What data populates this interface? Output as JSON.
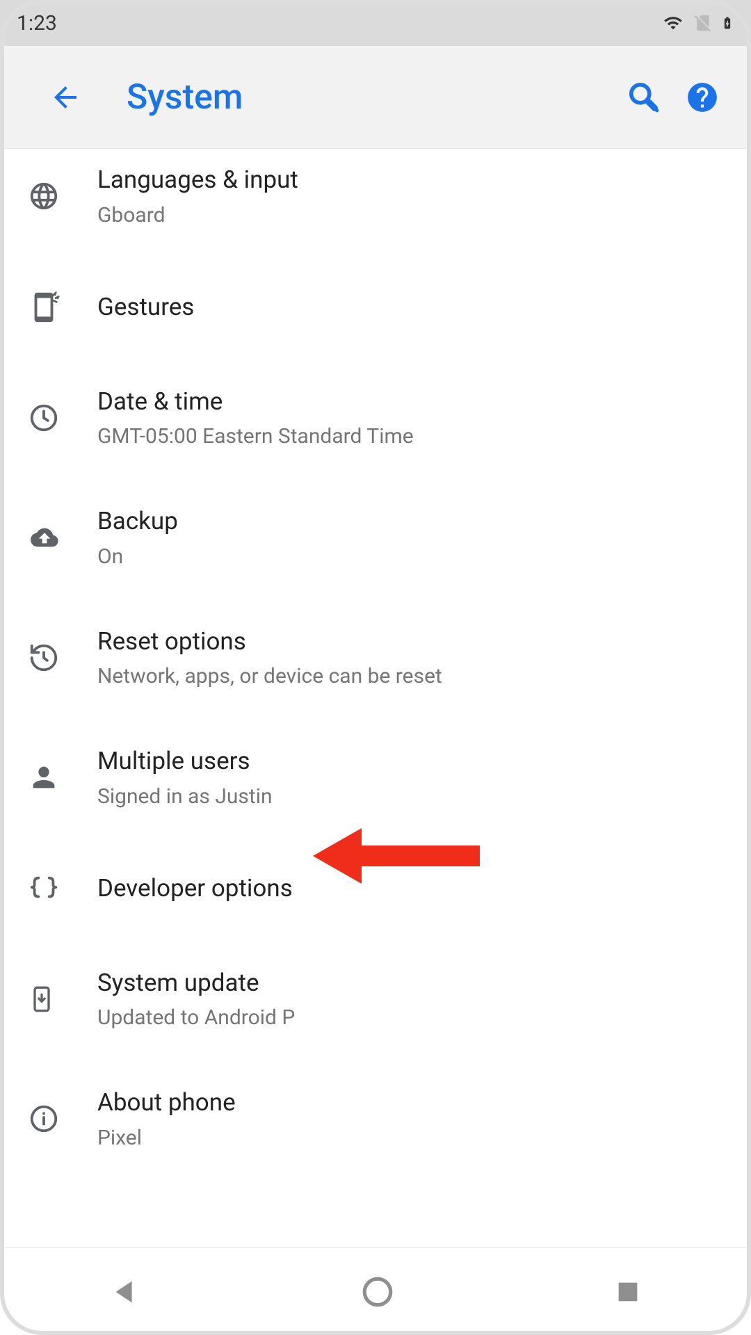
{
  "status": {
    "time": "1:23"
  },
  "appbar": {
    "title": "System"
  },
  "items": [
    {
      "label": "Languages & input",
      "sub": "Gboard"
    },
    {
      "label": "Gestures",
      "sub": ""
    },
    {
      "label": "Date & time",
      "sub": "GMT-05:00 Eastern Standard Time"
    },
    {
      "label": "Backup",
      "sub": "On"
    },
    {
      "label": "Reset options",
      "sub": "Network, apps, or device can be reset"
    },
    {
      "label": "Multiple users",
      "sub": "Signed in as Justin"
    },
    {
      "label": "Developer options",
      "sub": ""
    },
    {
      "label": "System update",
      "sub": "Updated to Android P"
    },
    {
      "label": "About phone",
      "sub": "Pixel"
    }
  ],
  "colors": {
    "accent": "#1a73e8",
    "annotation": "#f02d1a"
  }
}
